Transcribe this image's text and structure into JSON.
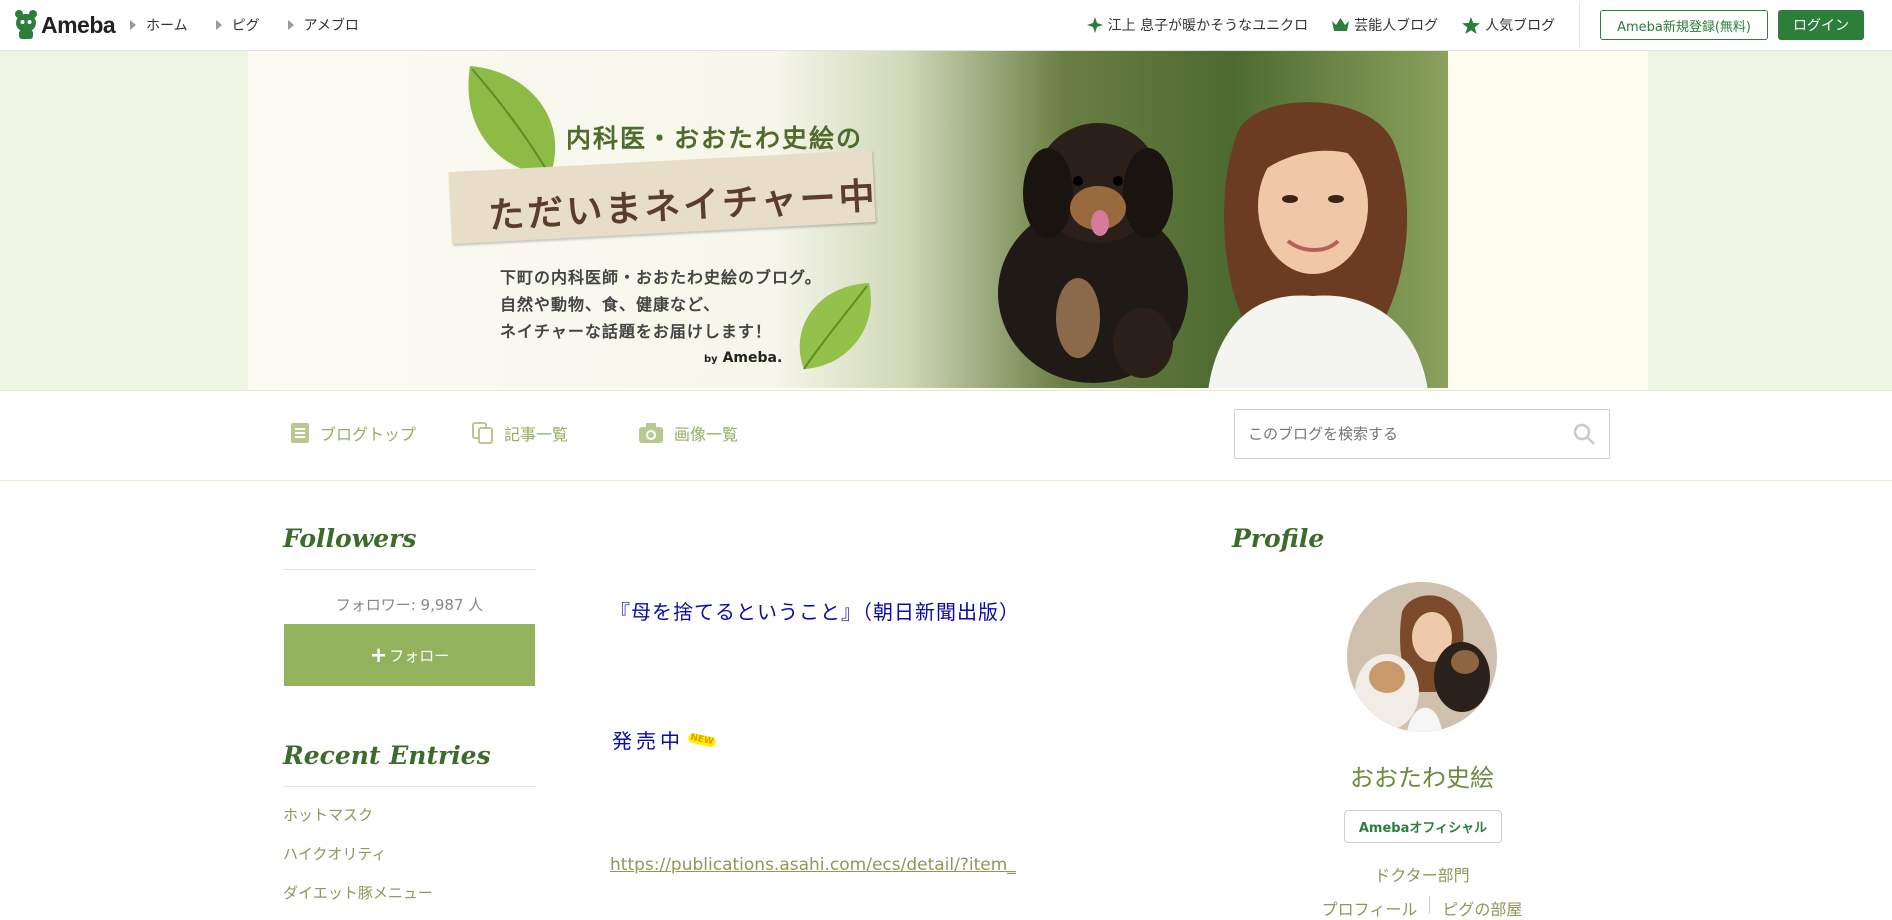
{
  "topbar": {
    "logo_text": "Ameba",
    "nav": [
      "ホーム",
      "ピグ",
      "アメブロ"
    ],
    "links": [
      {
        "label": "江上 息子が暖かそうなユニクロ",
        "icon": "sparkle-icon"
      },
      {
        "label": "芸能人ブログ",
        "icon": "crown-icon"
      },
      {
        "label": "人気ブログ",
        "icon": "star-icon"
      }
    ],
    "register_label": "Ameba新規登録(無料)",
    "login_label": "ログイン",
    "accent": "#2d7d3b"
  },
  "banner": {
    "title_small": "内科医・おおたわ史絵の",
    "title_big": "ただいまネイチャー中",
    "desc": [
      "下町の内科医師・おおたわ史絵のブログ。",
      "自然や動物、食、健康など、",
      "ネイチャーな話題をお届けします！"
    ],
    "by": "by",
    "brand": "Ameba."
  },
  "blognav": {
    "items": [
      {
        "label": "ブログトップ",
        "icon": "list-icon"
      },
      {
        "label": "記事一覧",
        "icon": "copy-icon"
      },
      {
        "label": "画像一覧",
        "icon": "camera-icon"
      }
    ],
    "search_placeholder": "このブログを検索する",
    "accent": "#95ae61"
  },
  "sidebar": {
    "followers_heading": "Followers",
    "followers_count": "フォロワー: 9,987 人",
    "follow_label": "フォロー",
    "follow_plus": "+",
    "recent_heading": "Recent Entries",
    "entries": [
      "ホットマスク",
      "ハイクオリティ",
      "ダイエット豚メニュー"
    ]
  },
  "main": {
    "title": "『母を捨てるということ』（朝日新聞出版）",
    "sale": "発売中",
    "new_badge": "NEW",
    "link": "https://publications.asahi.com/ecs/detail/?item_"
  },
  "profile": {
    "heading": "Profile",
    "name": "おおたわ史絵",
    "official_label": "Amebaオフィシャル",
    "category": "ドクター部門",
    "links": [
      "プロフィール",
      "ピグの部屋"
    ]
  }
}
